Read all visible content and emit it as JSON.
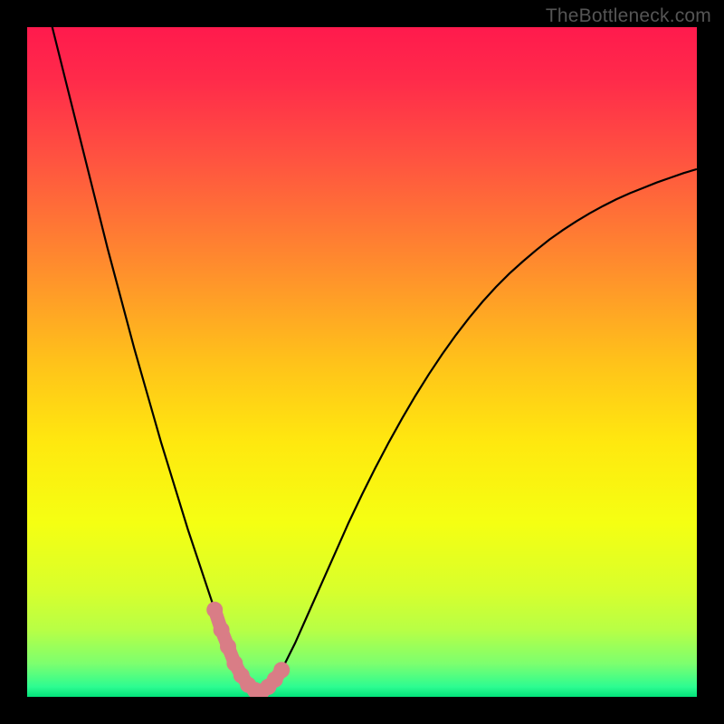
{
  "watermark": "TheBottleneck.com",
  "colors": {
    "frame": "#000000",
    "curve": "#000000",
    "marker_fill": "#d97d86",
    "gradient_stops": [
      {
        "offset": 0.0,
        "color": "#ff1a4d"
      },
      {
        "offset": 0.08,
        "color": "#ff2b4a"
      },
      {
        "offset": 0.2,
        "color": "#ff5440"
      },
      {
        "offset": 0.35,
        "color": "#ff8a2e"
      },
      {
        "offset": 0.5,
        "color": "#ffc21a"
      },
      {
        "offset": 0.62,
        "color": "#ffe80f"
      },
      {
        "offset": 0.74,
        "color": "#f5ff12"
      },
      {
        "offset": 0.84,
        "color": "#d8ff2c"
      },
      {
        "offset": 0.9,
        "color": "#b8ff45"
      },
      {
        "offset": 0.95,
        "color": "#7dff6e"
      },
      {
        "offset": 0.985,
        "color": "#2dfc91"
      },
      {
        "offset": 1.0,
        "color": "#03e27a"
      }
    ]
  },
  "chart_data": {
    "type": "line",
    "title": "",
    "xlabel": "",
    "ylabel": "",
    "xlim": [
      0,
      100
    ],
    "ylim": [
      0,
      100
    ],
    "x": [
      0,
      2,
      4,
      6,
      8,
      10,
      12,
      14,
      16,
      18,
      20,
      22,
      24,
      26,
      28,
      29,
      30,
      31,
      32,
      33,
      34,
      35,
      36,
      38,
      40,
      42,
      44,
      46,
      48,
      50,
      52,
      54,
      56,
      58,
      60,
      62,
      64,
      66,
      68,
      70,
      72,
      74,
      76,
      78,
      80,
      82,
      84,
      86,
      88,
      90,
      92,
      94,
      96,
      98,
      100
    ],
    "y": [
      115,
      107,
      99,
      91,
      83,
      75,
      67,
      59.5,
      52,
      45,
      38,
      31.5,
      25,
      19,
      13,
      10,
      7.5,
      5,
      3.2,
      1.8,
      1,
      0.8,
      1.5,
      4,
      8,
      12.5,
      17,
      21.5,
      26,
      30.2,
      34.2,
      38,
      41.6,
      45,
      48.2,
      51.2,
      54,
      56.6,
      59,
      61.2,
      63.2,
      65,
      66.7,
      68.3,
      69.7,
      71,
      72.2,
      73.3,
      74.3,
      75.2,
      76,
      76.8,
      77.5,
      78.2,
      78.8
    ],
    "highlight_segment": {
      "x": [
        28,
        29,
        30,
        31,
        32,
        33,
        34,
        35,
        36,
        37,
        38
      ],
      "y": [
        13,
        10,
        7.5,
        5,
        3.2,
        1.8,
        1,
        0.8,
        1.5,
        2.6,
        4
      ]
    }
  }
}
